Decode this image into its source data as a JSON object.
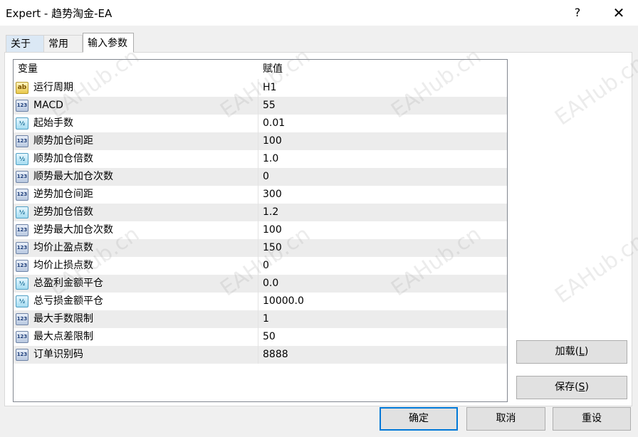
{
  "window": {
    "title": "Expert - 趋势淘金-EA",
    "help_label": "?",
    "close_label": "✕"
  },
  "tabs": [
    {
      "label": "关于"
    },
    {
      "label": "常用"
    },
    {
      "label": "输入参数",
      "active": true
    }
  ],
  "table": {
    "headers": {
      "name": "变量",
      "value": "赋值"
    },
    "rows": [
      {
        "type": "string",
        "icon": "ab",
        "name": "运行周期",
        "value": "H1"
      },
      {
        "type": "int",
        "icon": "123",
        "name": "MACD",
        "value": "55"
      },
      {
        "type": "double",
        "icon": "½",
        "name": "起始手数",
        "value": "0.01"
      },
      {
        "type": "int",
        "icon": "123",
        "name": "顺势加仓间距",
        "value": "100"
      },
      {
        "type": "double",
        "icon": "½",
        "name": "顺势加仓倍数",
        "value": "1.0"
      },
      {
        "type": "int",
        "icon": "123",
        "name": "顺势最大加仓次数",
        "value": "0"
      },
      {
        "type": "int",
        "icon": "123",
        "name": "逆势加仓间距",
        "value": "300"
      },
      {
        "type": "double",
        "icon": "½",
        "name": "逆势加仓倍数",
        "value": "1.2"
      },
      {
        "type": "int",
        "icon": "123",
        "name": "逆势最大加仓次数",
        "value": "100"
      },
      {
        "type": "int",
        "icon": "123",
        "name": "均价止盈点数",
        "value": "150"
      },
      {
        "type": "int",
        "icon": "123",
        "name": "均价止损点数",
        "value": "0"
      },
      {
        "type": "double",
        "icon": "½",
        "name": "总盈利金额平仓",
        "value": "0.0"
      },
      {
        "type": "double",
        "icon": "½",
        "name": "总亏损金额平仓",
        "value": "10000.0"
      },
      {
        "type": "int",
        "icon": "123",
        "name": "最大手数限制",
        "value": "1"
      },
      {
        "type": "int",
        "icon": "123",
        "name": "最大点差限制",
        "value": "50"
      },
      {
        "type": "int",
        "icon": "123",
        "name": "订单识别码",
        "value": "8888"
      }
    ]
  },
  "side_buttons": {
    "load": {
      "label": "加载(",
      "key": "L",
      "suffix": ")"
    },
    "save": {
      "label": "保存(",
      "key": "S",
      "suffix": ")"
    }
  },
  "buttons": {
    "ok": "确定",
    "cancel": "取消",
    "reset": "重设"
  },
  "watermark": "EAHub.cn",
  "colors": {
    "accent": "#0078d7",
    "row_alt": "#ececec"
  }
}
